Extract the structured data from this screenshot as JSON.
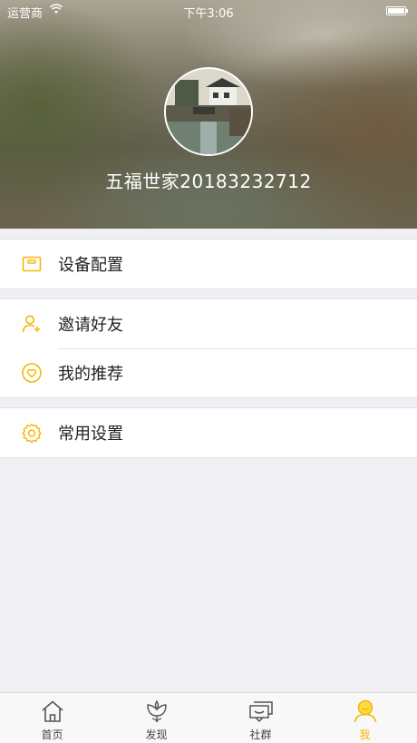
{
  "status_bar": {
    "carrier": "运营商",
    "time": "下午3:06"
  },
  "profile": {
    "nickname": "五福世家20183232712"
  },
  "menu_groups": [
    {
      "items": [
        {
          "label": "设备配置",
          "icon": "device-config-icon"
        }
      ]
    },
    {
      "items": [
        {
          "label": "邀请好友",
          "icon": "invite-friend-icon"
        },
        {
          "label": "我的推荐",
          "icon": "recommend-heart-icon"
        }
      ]
    },
    {
      "items": [
        {
          "label": "常用设置",
          "icon": "gear-icon"
        }
      ]
    }
  ],
  "tabbar": {
    "tabs": [
      {
        "label": "首页",
        "icon": "home-icon",
        "active": false
      },
      {
        "label": "发现",
        "icon": "discover-flower-icon",
        "active": false
      },
      {
        "label": "社群",
        "icon": "community-chat-icon",
        "active": false
      },
      {
        "label": "我",
        "icon": "me-smile-icon",
        "active": true
      }
    ]
  },
  "colors": {
    "accent": "#f5b800",
    "background": "#efeff4",
    "tab_inactive": "#444444"
  }
}
